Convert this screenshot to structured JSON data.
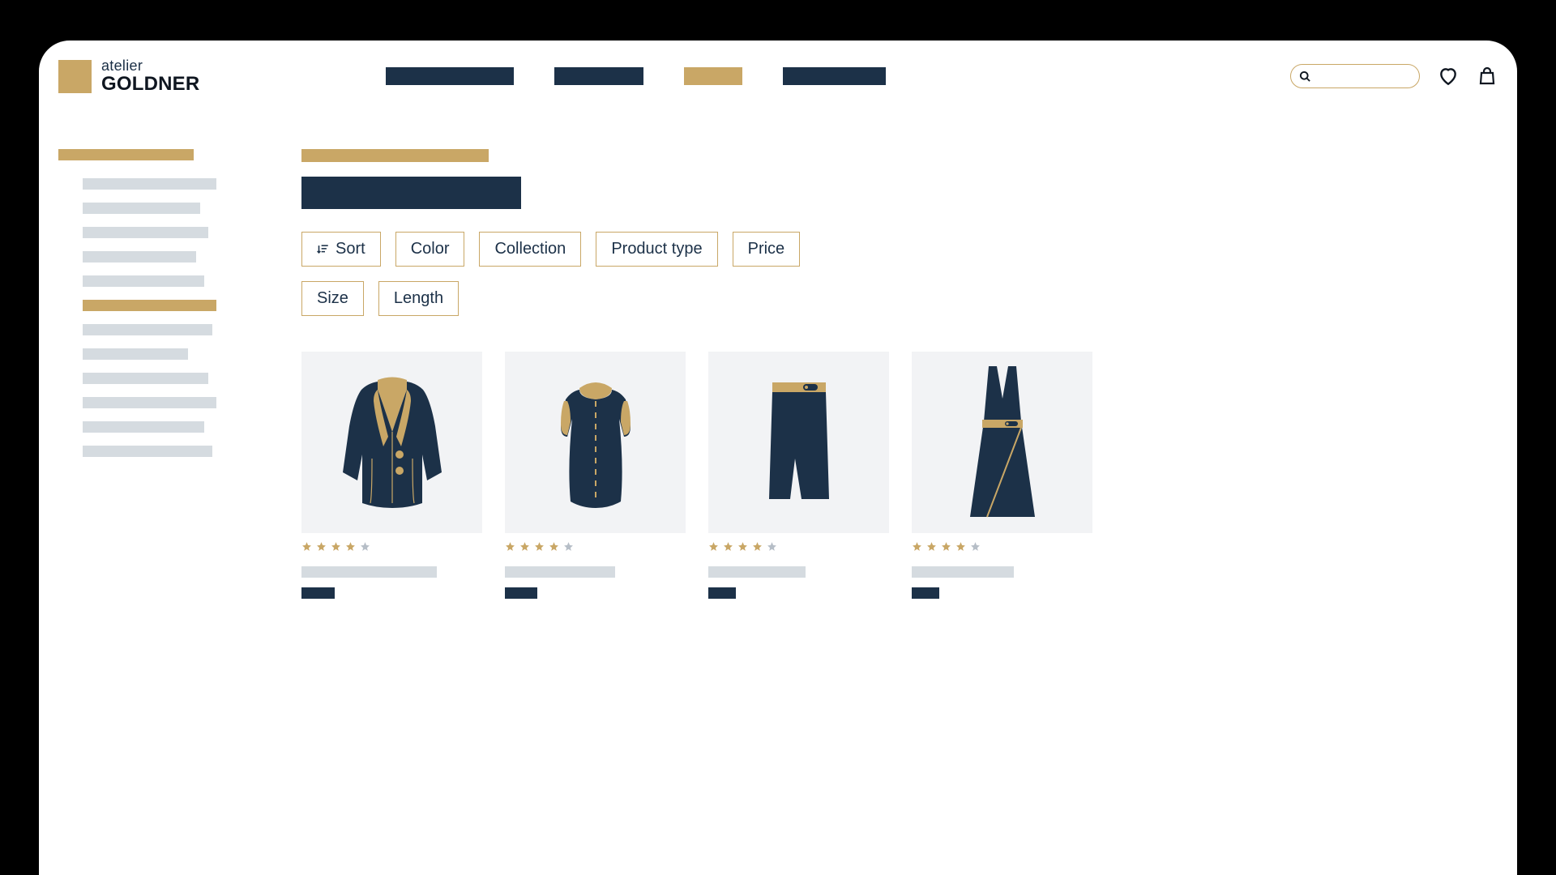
{
  "logo": {
    "atelier": "atelier",
    "goldner": "GOLDNER"
  },
  "filters": {
    "sort": "Sort",
    "color": "Color",
    "collection": "Collection",
    "product_type": "Product type",
    "price": "Price",
    "size": "Size",
    "length": "Length"
  },
  "products": [
    {
      "rating": 4,
      "type": "blazer"
    },
    {
      "rating": 4,
      "type": "blouse"
    },
    {
      "rating": 4,
      "type": "skirt"
    },
    {
      "rating": 4,
      "type": "dress"
    }
  ],
  "colors": {
    "navy": "#1c3148",
    "gold": "#c9a766",
    "grey": "#d5dbe0"
  }
}
